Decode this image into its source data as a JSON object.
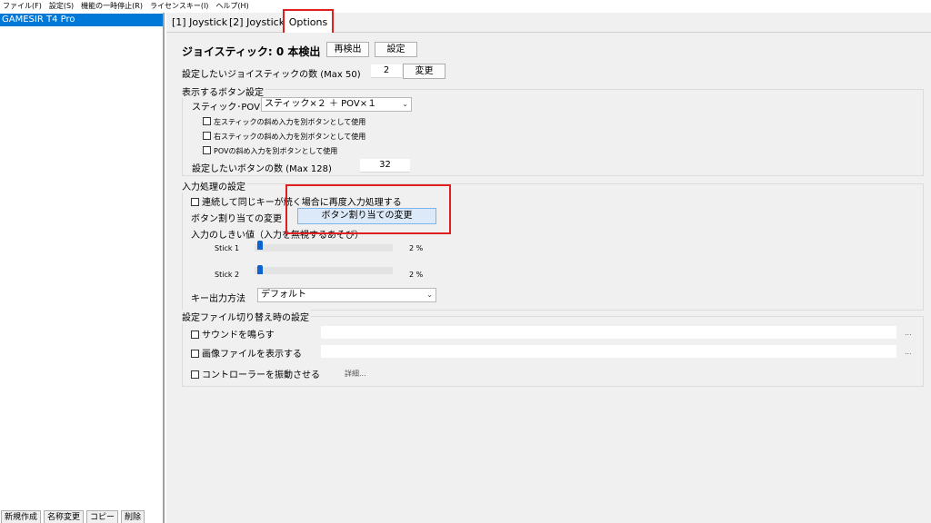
{
  "menu": [
    "ファイル(F)",
    "設定(S)",
    "機能の一時停止(R)",
    "ライセンスキー(I)",
    "ヘルプ(H)"
  ],
  "device_list": {
    "selected": "GAMESIR T4 Pro"
  },
  "bottom_buttons": [
    "新規作成",
    "名称変更",
    "コピー",
    "削除"
  ],
  "tabs": [
    "[1] Joystick",
    "[2] Joystick",
    "Options"
  ],
  "joystick": {
    "status": "ジョイスティック: 0 本検出",
    "redetect": "再検出",
    "settings": "設定",
    "count_label": "設定したいジョイスティックの数 (Max 50)",
    "count_value": "2",
    "change": "変更"
  },
  "button_display": {
    "group_title": "表示するボタン設定",
    "stick_pov_label": "スティック･POV",
    "stick_pov_value": "スティック×２ ＋ POV×１",
    "cb_left": "左スティックの斜め入力を別ボタンとして使用",
    "cb_right": "右スティックの斜め入力を別ボタンとして使用",
    "cb_pov": "POVの斜め入力を別ボタンとして使用",
    "button_count_label": "設定したいボタンの数 (Max 128)",
    "button_count_value": "32"
  },
  "input_processing": {
    "group_title": "入力処理の設定",
    "cb_repeat": "連続して同じキーが続く場合に再度入力処理する",
    "assign_label": "ボタン割り当ての変更",
    "assign_button": "ボタン割り当ての変更",
    "threshold_label": "入力のしきい値（入力を無視するあそび）",
    "stick1_label": "Stick 1",
    "stick1_value": "2 %",
    "stick1_level": 0.02,
    "stick2_label": "Stick 2",
    "stick2_value": "2 %",
    "stick2_level": 0.02,
    "key_output_label": "キー出力方法",
    "key_output_value": "デフォルト"
  },
  "profile_switch": {
    "group_title": "設定ファイル切り替え時の設定",
    "cb_sound": "サウンドを鳴らす",
    "cb_image": "画像ファイルを表示する",
    "cb_vibrate": "コントローラーを振動させる",
    "details": "詳細...",
    "browse": "..."
  },
  "colors": {
    "selection": "#0078d7",
    "highlight_box": "#e02020",
    "slider_thumb": "#0b63d1",
    "accent_button": "#dbe9f8"
  }
}
